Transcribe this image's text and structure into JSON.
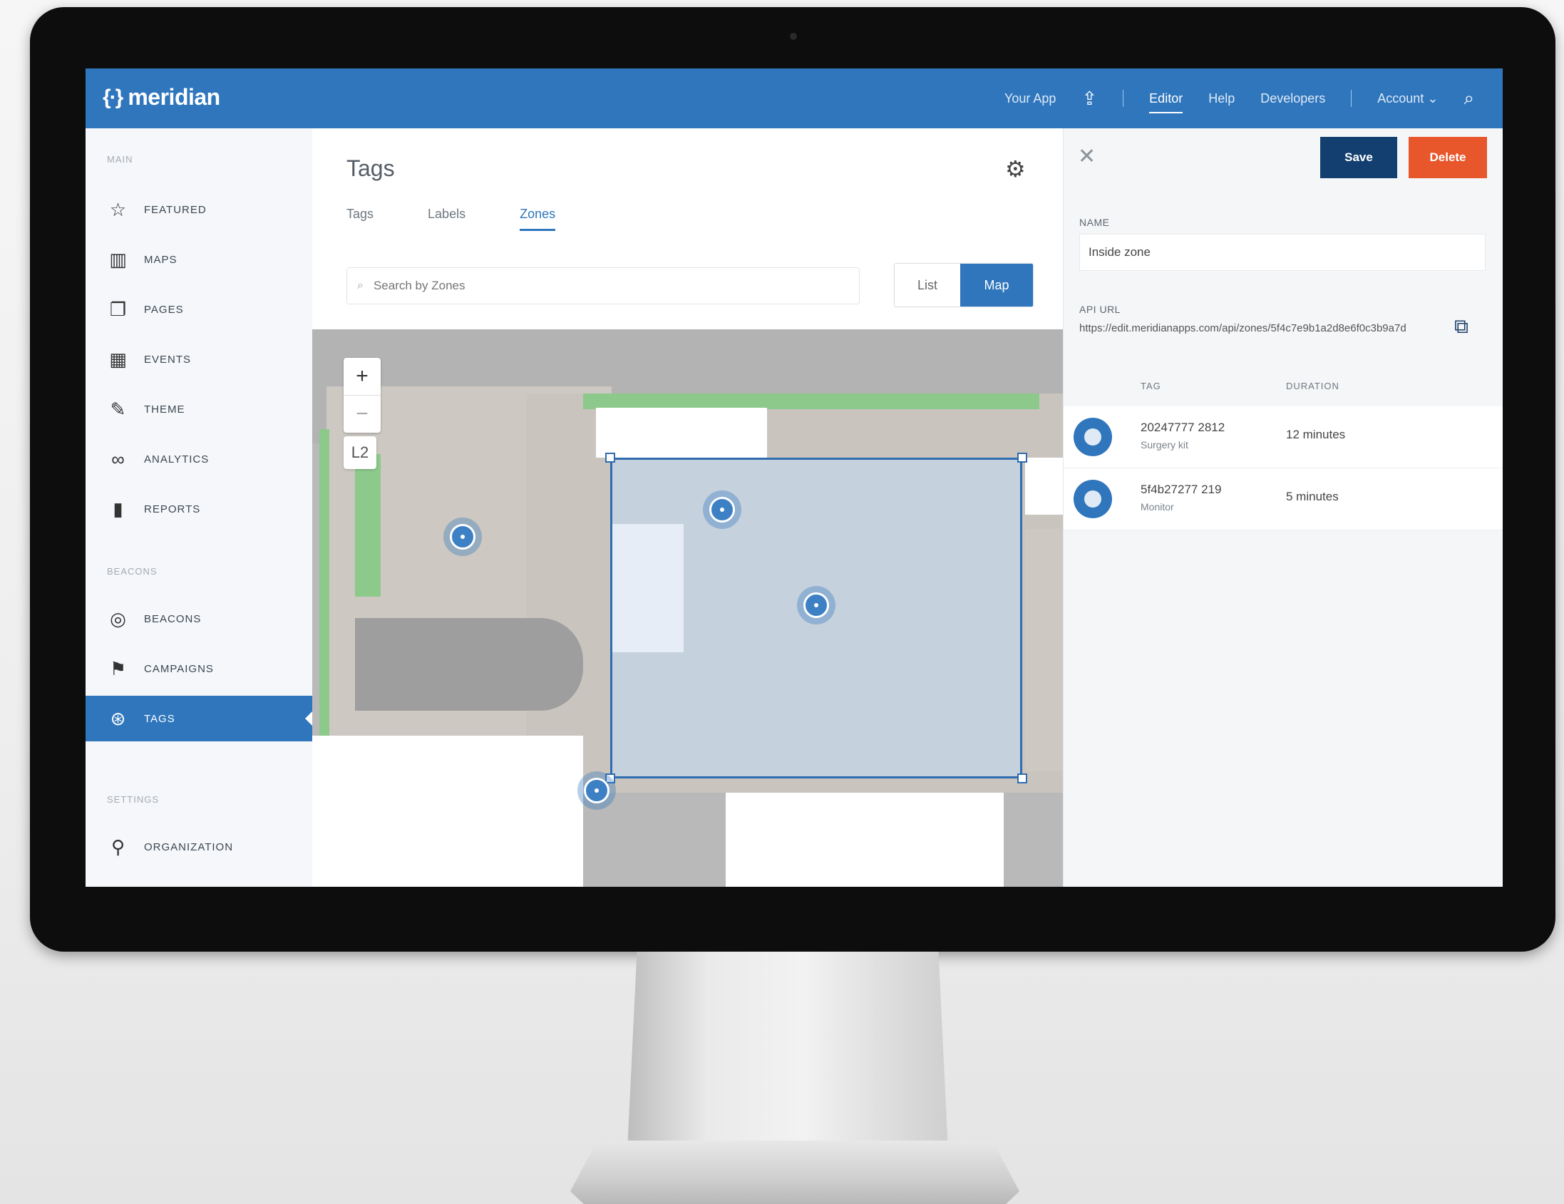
{
  "brand": {
    "name": "meridian",
    "logo_icon": "braces-logo-icon"
  },
  "topnav": {
    "your_app": "Your App",
    "share_icon": "share-icon",
    "items": [
      "Editor",
      "Help",
      "Developers"
    ],
    "active": "Editor",
    "account": "Account",
    "search_icon": "search-icon"
  },
  "sidebar": {
    "sections": [
      "MAIN",
      "BEACONS",
      "SETTINGS"
    ],
    "items": [
      {
        "label": "FEATURED",
        "icon": "star-icon"
      },
      {
        "label": "MAPS",
        "icon": "map-icon"
      },
      {
        "label": "PAGES",
        "icon": "pages-icon"
      },
      {
        "label": "EVENTS",
        "icon": "calendar-icon"
      },
      {
        "label": "THEME",
        "icon": "brush-icon"
      },
      {
        "label": "ANALYTICS",
        "icon": "analytics-icon"
      },
      {
        "label": "REPORTS",
        "icon": "bar-chart-icon"
      },
      {
        "label": "BEACONS",
        "icon": "beacon-icon"
      },
      {
        "label": "CAMPAIGNS",
        "icon": "megaphone-icon"
      },
      {
        "label": "TAGS",
        "icon": "tag-icon"
      },
      {
        "label": "ORGANIZATION",
        "icon": "org-icon"
      }
    ],
    "active": "TAGS"
  },
  "main": {
    "title": "Tags",
    "tabs": [
      "Tags",
      "Labels",
      "Zones"
    ],
    "active_tab": "Zones",
    "search_placeholder": "Search by Zones",
    "view_toggle": [
      "List",
      "Map"
    ],
    "active_view": "Map",
    "map": {
      "zoom_in": "+",
      "zoom_out": "−",
      "level": "L2"
    }
  },
  "panel": {
    "save": "Save",
    "delete": "Delete",
    "name_label": "NAME",
    "name_value": "Inside zone",
    "api_label": "API URL",
    "api_url": "https://edit.meridianapps.com/api/zones/5f4c7e9b1a2d8e6f0c3b9a7d",
    "columns": {
      "tags": "TAG",
      "duration": "DURATION"
    },
    "rows": [
      {
        "id": "20247777 2812",
        "sub": "Surgery kit",
        "duration": "12 minutes"
      },
      {
        "id": "5f4b27277 219",
        "sub": "Monitor",
        "duration": "5 minutes"
      }
    ]
  },
  "colors": {
    "brand": "#2f76bd",
    "save": "#123f6f",
    "delete": "#e8572c",
    "zone_border": "#2f6db0"
  }
}
